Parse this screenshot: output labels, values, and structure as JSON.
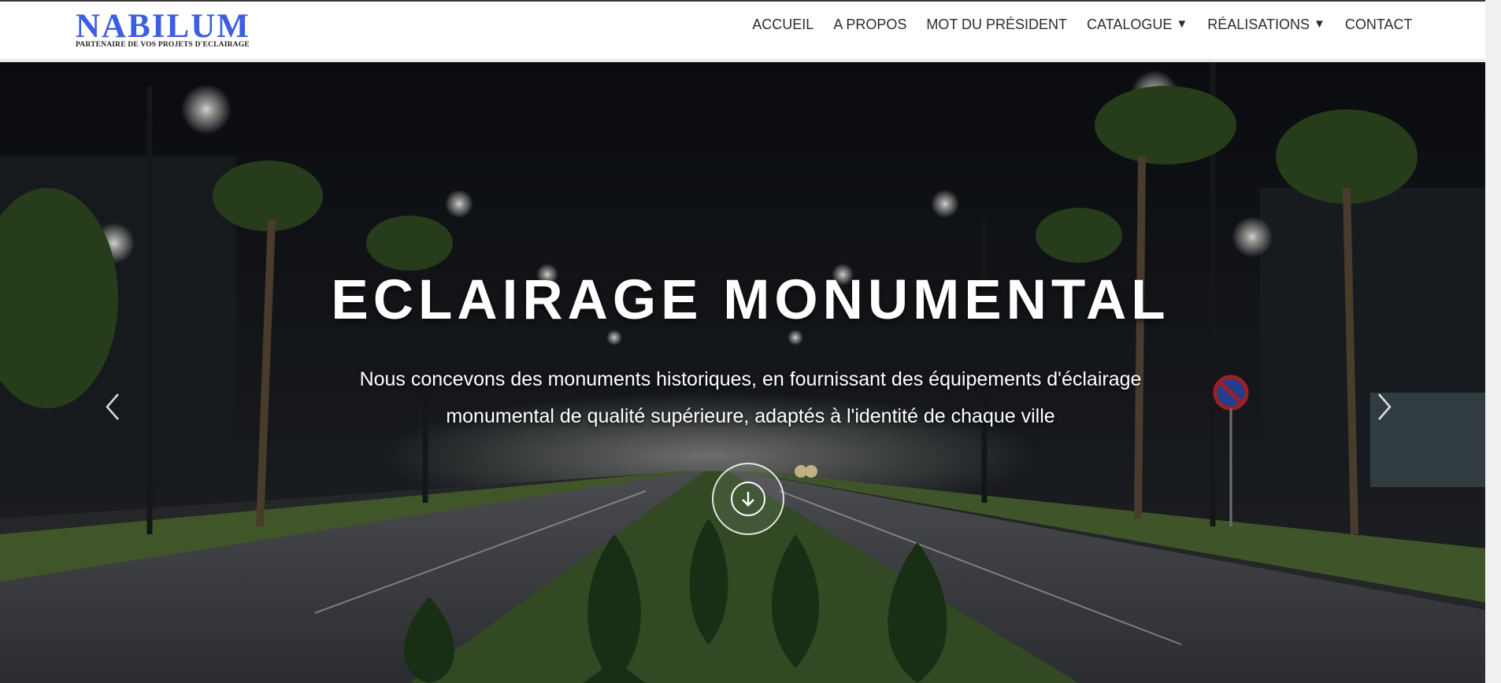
{
  "logo": {
    "title": "NABILUM",
    "subtitle": "PARTENAIRE DE VOS PROJETS D'ECLAIRAGE"
  },
  "nav": {
    "items": [
      {
        "label": "ACCUEIL",
        "has_dropdown": false
      },
      {
        "label": "A PROPOS",
        "has_dropdown": false
      },
      {
        "label": "MOT DU PRÉSIDENT",
        "has_dropdown": false
      },
      {
        "label": "CATALOGUE",
        "has_dropdown": true,
        "caret": "▼"
      },
      {
        "label": "RÉALISATIONS",
        "has_dropdown": true,
        "caret": "▼"
      },
      {
        "label": "CONTACT",
        "has_dropdown": false
      }
    ]
  },
  "hero": {
    "title": "ECLAIRAGE MONUMENTAL",
    "text": "Nous concevons des monuments historiques, en fournissant des équipements d'éclairage monumental de qualité supérieure, adaptés à l'identité de chaque ville",
    "prev_icon": "chevron-left-icon",
    "next_icon": "chevron-right-icon",
    "scroll_icon": "arrow-down-circle-icon"
  },
  "colors": {
    "brand": "#3d5ee0",
    "nav_text": "#2c2c2c",
    "hero_text": "#ffffff"
  }
}
